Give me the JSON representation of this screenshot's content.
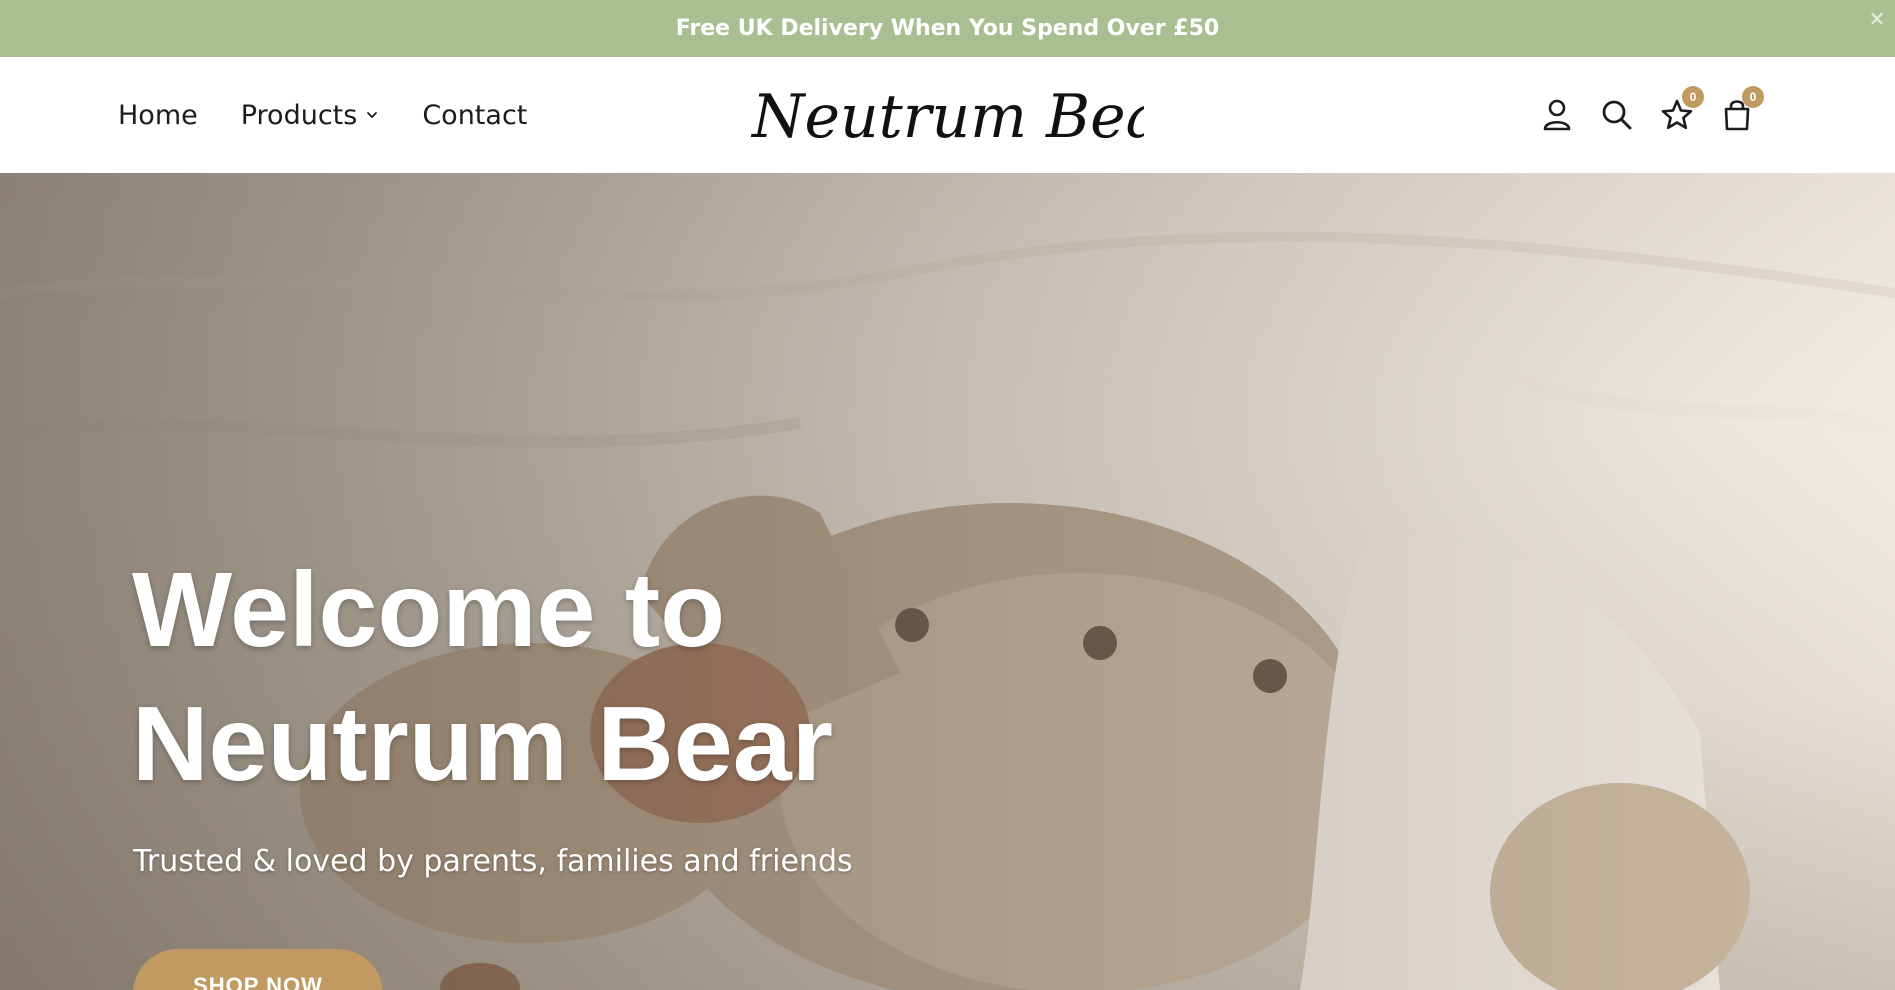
{
  "announcement": {
    "text": "Free UK Delivery When You Spend Over £50",
    "close_label": "×"
  },
  "nav": {
    "items": [
      {
        "label": "Home"
      },
      {
        "label": "Products"
      },
      {
        "label": "Contact"
      }
    ]
  },
  "logo": {
    "text": "Neutrum Bear"
  },
  "header_icons": {
    "account": "user-icon",
    "search": "search-icon",
    "wishlist": "star-icon",
    "cart": "bag-icon",
    "wishlist_count": "0",
    "cart_count": "0"
  },
  "hero": {
    "title_line1": "Welcome to",
    "title_line2": "Neutrum Bear",
    "subtitle": "Trusted & loved by parents, families and friends",
    "button_label": "SHOP NOW"
  },
  "colors": {
    "announcement_bg": "#a9bf91",
    "accent": "#c19a62",
    "text_dark": "#1c1c1c"
  }
}
